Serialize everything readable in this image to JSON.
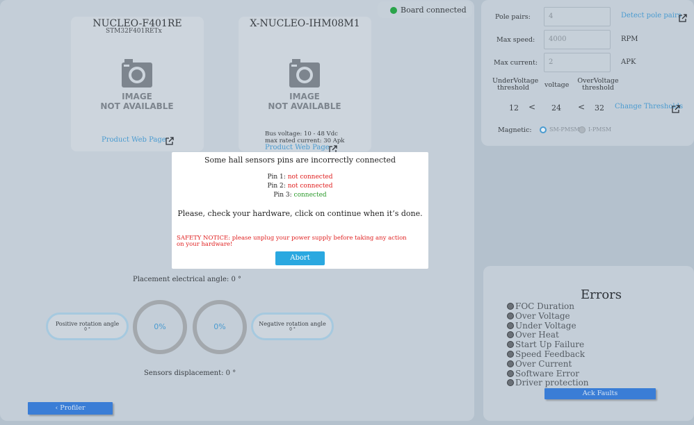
{
  "status": {
    "label": "Board connected",
    "color": "#2aa44a"
  },
  "cards": [
    {
      "title": "NUCLEO-F401RE",
      "subtitle": "STM32F401RETx",
      "image_text": [
        "IMAGE",
        "NOT AVAILABLE"
      ],
      "link": "Product Web Page"
    },
    {
      "title": "X-NUCLEO-IHM08M1",
      "image_text": [
        "IMAGE",
        "NOT AVAILABLE"
      ],
      "bus_voltage": "Bus voltage: 10 - 48 Vdc",
      "rated_current": "max rated current: 30 Apk",
      "link": "Product Web Page"
    }
  ],
  "motor": {
    "pole_pairs": {
      "label": "Pole pairs:",
      "value": "4",
      "action": "Detect pole pairs"
    },
    "max_speed": {
      "label": "Max speed:",
      "value": "4000",
      "unit": "RPM"
    },
    "max_current": {
      "label": "Max current:",
      "value": "2",
      "unit": "APK"
    },
    "under_voltage": {
      "label_1": "UnderVoltage",
      "label_2": "threshold",
      "value": "12"
    },
    "voltage": {
      "label": "voltage",
      "value": "24"
    },
    "over_voltage": {
      "label_1": "OverVoltage",
      "label_2": "threshold",
      "value": "32"
    },
    "change_thresholds": "Change Thresholds",
    "magnetic": {
      "label": "Magnetic:",
      "options": [
        "SM-PMSM",
        "I-PMSM"
      ],
      "selected": "SM-PMSM"
    }
  },
  "sensors": {
    "placement": "Placement electrical angle: 0 °",
    "positive": {
      "label": "Positive rotation angle",
      "value": "0 °"
    },
    "negative": {
      "label": "Negative rotation angle",
      "value": "0 °"
    },
    "ring_left": "0%",
    "ring_right": "0%",
    "displacement": "Sensors displacement: 0 °"
  },
  "profiler_button": "‹ Profiler",
  "errors": {
    "title": "Errors",
    "items": [
      "FOC Duration",
      "Over Voltage",
      "Under Voltage",
      "Over Heat",
      "Start Up Failure",
      "Speed Feedback",
      "Over Current",
      "Software Error",
      "Driver protection"
    ],
    "ack_button": "Ack Faults"
  },
  "dialog": {
    "title": "Some hall sensors pins are incorrectly connected",
    "pins": [
      {
        "label": "Pin 1:",
        "status": "not connected",
        "ok": false
      },
      {
        "label": "Pin 2:",
        "status": "not connected",
        "ok": false
      },
      {
        "label": "Pin 3:",
        "status": "connected",
        "ok": true
      }
    ],
    "message": "Please, check your hardware, click on continue when it’s done.",
    "safety_line1": "SAFETY NOTICE: please unplug your power supply before taking any action",
    "safety_line2": "on your hardware!",
    "abort_button": "Abort",
    "accent": "#2aa8e0"
  }
}
